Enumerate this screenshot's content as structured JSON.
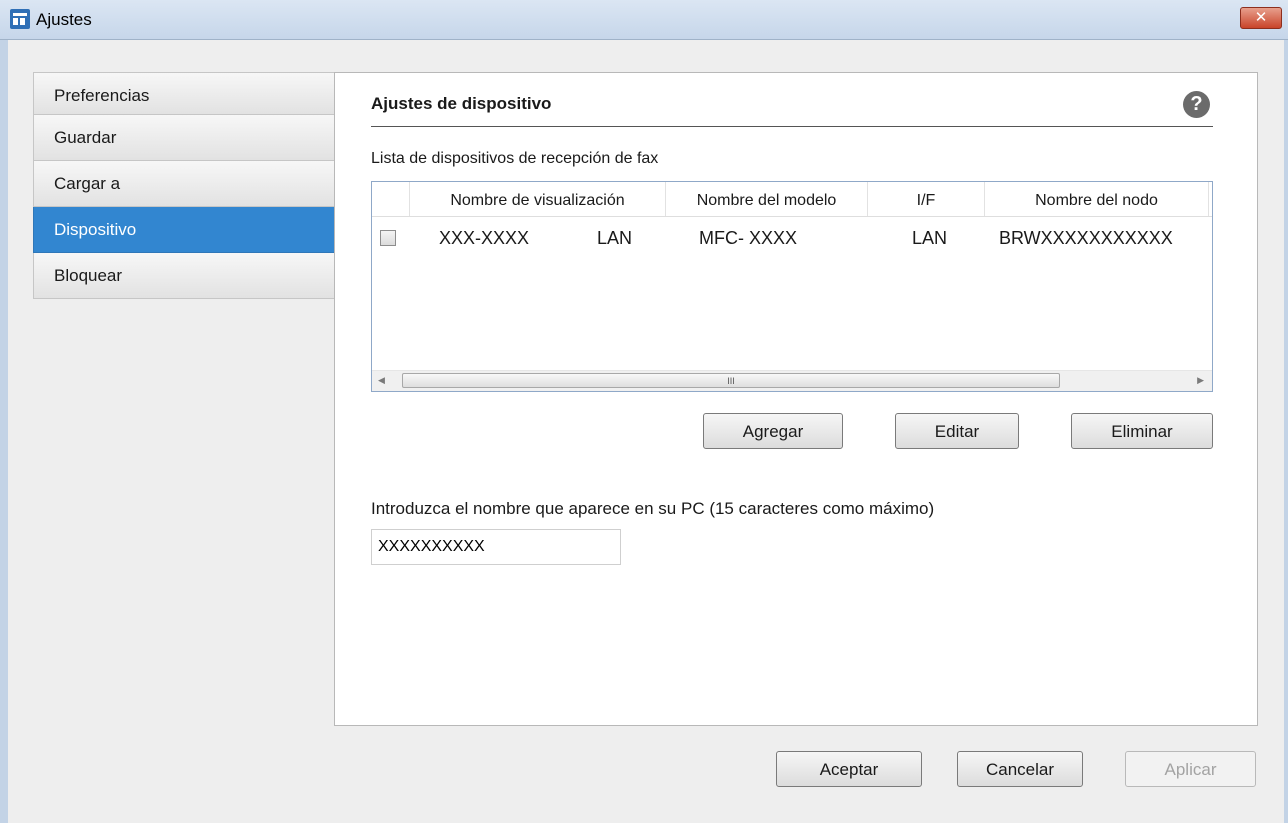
{
  "window": {
    "title": "Ajustes",
    "close_label": "✕"
  },
  "sidebar": {
    "items": [
      {
        "label": "Preferencias"
      },
      {
        "label": "Guardar"
      },
      {
        "label": "Cargar a"
      },
      {
        "label": "Dispositivo",
        "selected": true
      },
      {
        "label": "Bloquear"
      }
    ]
  },
  "panel": {
    "title": "Ajustes de dispositivo",
    "help_icon": "?",
    "list_caption": "Lista de dispositivos de recepción de fax",
    "columns": [
      "Nombre de visualización",
      "Nombre del modelo",
      "I/F",
      "Nombre del nodo"
    ],
    "rows": [
      {
        "display_name": "XXX-XXXX",
        "display_name_if": "LAN",
        "model": "MFC- XXXX",
        "interface": "LAN",
        "node": "BRWXXXXXXXXXXX",
        "checked": false
      }
    ],
    "scroll_thumb_grip": "III",
    "buttons": {
      "add": "Agregar",
      "edit": "Editar",
      "delete": "Eliminar"
    },
    "name_label": "Introduzca el nombre que aparece en su PC (15 caracteres como máximo)",
    "name_value": "XXXXXXXXXX"
  },
  "footer": {
    "ok": "Aceptar",
    "cancel": "Cancelar",
    "apply": "Aplicar"
  },
  "colors": {
    "accent": "#3286d0",
    "close": "#c9442a"
  }
}
